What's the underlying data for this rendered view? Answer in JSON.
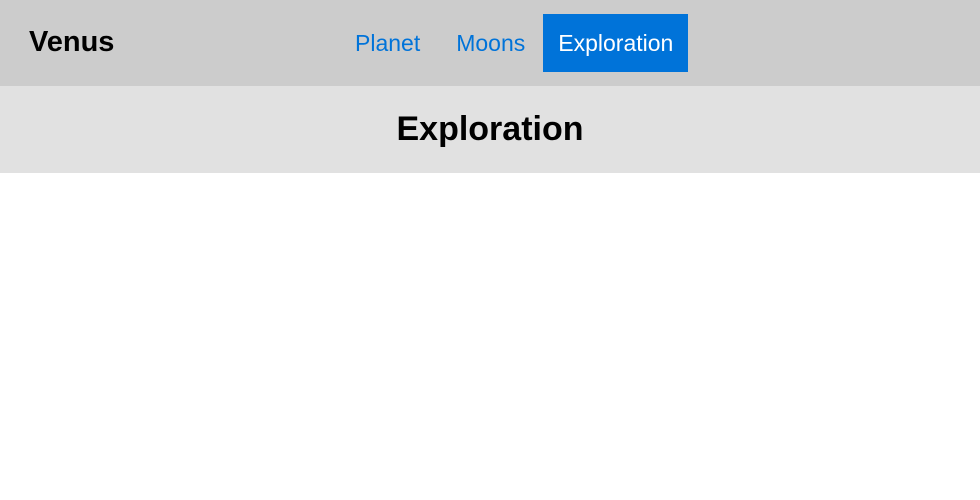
{
  "header": {
    "brand": "Venus",
    "nav": [
      {
        "label": "Planet",
        "active": false
      },
      {
        "label": "Moons",
        "active": false
      },
      {
        "label": "Exploration",
        "active": true
      }
    ]
  },
  "page": {
    "title": "Exploration"
  },
  "colors": {
    "topbar_bg": "#cccccc",
    "subheader_bg": "#e1e1e1",
    "accent": "#0073d9",
    "active_text": "#ffffff"
  }
}
